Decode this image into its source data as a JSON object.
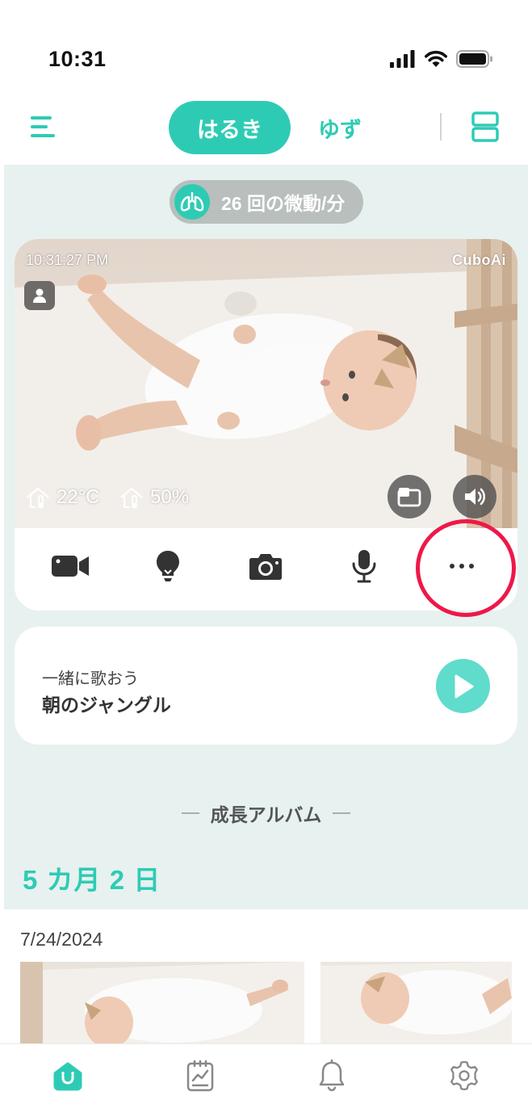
{
  "status_bar": {
    "time": "10:31"
  },
  "header": {
    "tabs": [
      {
        "label": "はるき",
        "active": true
      },
      {
        "label": "ゆず",
        "active": false
      }
    ]
  },
  "breathing": {
    "label": "26 回の微動/分"
  },
  "camera": {
    "timestamp": "10:31:27 PM",
    "brand": "CuboAi",
    "temperature": "22°C",
    "humidity": "50%",
    "toolbar": [
      "video-camera-icon",
      "lightbulb-icon",
      "camera-icon",
      "microphone-icon",
      "more-icon"
    ]
  },
  "song": {
    "subtitle": "一緒に歌おう",
    "title": "朝のジャングル"
  },
  "album": {
    "heading": "成長アルバム",
    "age": "5 カ月 2 日",
    "date": "7/24/2024"
  },
  "bottom_nav": {
    "items": [
      "home-icon",
      "journal-icon",
      "bell-icon",
      "settings-icon"
    ],
    "active": "home-icon"
  },
  "colors": {
    "accent": "#2ecbb4",
    "background": "#e7f1f0",
    "highlight": "#ee1849"
  }
}
